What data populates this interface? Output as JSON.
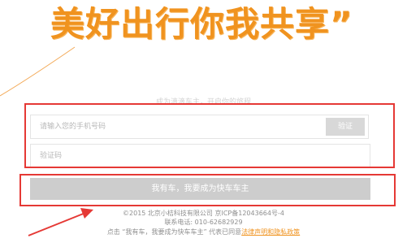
{
  "slogan": "美好出行你我共享”",
  "subtitle": "成为滴滴车主，开启你的旅程",
  "phone": {
    "placeholder": "请输入您的手机号码",
    "value": ""
  },
  "verify_button": "验证",
  "code": {
    "placeholder": "验证码",
    "value": ""
  },
  "submit_button": "我有车，我要成为快车车主",
  "footer": {
    "copyright": "©2015 北京小桔科技有限公司 京ICP备12043664号-4",
    "contact": "联系电话: 010-62682929",
    "agree_prefix": "点击 “我有车，我要成为快车车主” 代表已同意",
    "policy_link": "法律声明和隐私政策"
  },
  "colors": {
    "accent": "#f0931f",
    "annotation_red": "#e53935",
    "button_gray": "#cdcdcd"
  }
}
